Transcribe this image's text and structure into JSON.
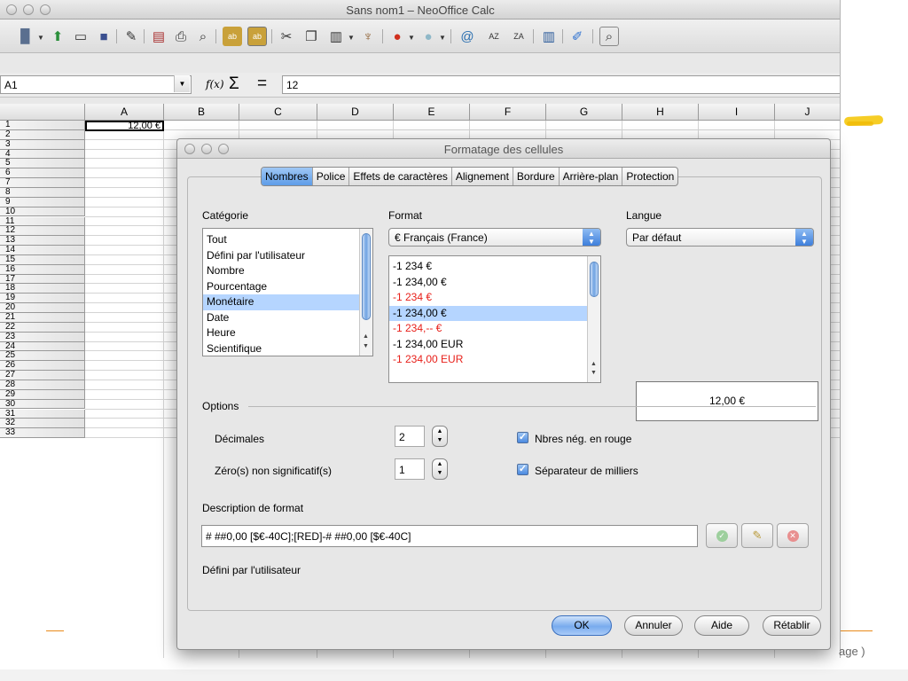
{
  "window": {
    "title": "Sans nom1 – NeoOffice Calc"
  },
  "formula_bar": {
    "cell_ref": "A1",
    "fx": "f(x)",
    "sum": "Σ",
    "equals": "=",
    "value": "12"
  },
  "grid": {
    "columns": [
      "A",
      "B",
      "C",
      "D",
      "E",
      "F",
      "G",
      "H",
      "I",
      "J"
    ],
    "rows": [
      "1",
      "2",
      "3",
      "4",
      "5",
      "6",
      "7",
      "8",
      "9",
      "10",
      "11",
      "12",
      "13",
      "14",
      "15",
      "16",
      "17",
      "18",
      "19",
      "20",
      "21",
      "22",
      "23",
      "24",
      "25",
      "26",
      "27",
      "28",
      "29",
      "30",
      "31",
      "32",
      "33"
    ],
    "a1_value": "12,00 €"
  },
  "dialog": {
    "title": "Formatage des cellules",
    "tabs": [
      "Nombres",
      "Police",
      "Effets de caractères",
      "Alignement",
      "Bordure",
      "Arrière-plan",
      "Protection"
    ],
    "active_tab": "Nombres",
    "category_label": "Catégorie",
    "categories": [
      "Tout",
      "Défini par l'utilisateur",
      "Nombre",
      "Pourcentage",
      "Monétaire",
      "Date",
      "Heure",
      "Scientifique"
    ],
    "selected_category": "Monétaire",
    "format_label": "Format",
    "format_dropdown": "€ Français (France)",
    "formats": [
      {
        "text": "-1 234 €",
        "red": false
      },
      {
        "text": "-1 234,00 €",
        "red": false
      },
      {
        "text": "-1 234 €",
        "red": true
      },
      {
        "text": "-1 234,00 €",
        "red": false,
        "selected": true
      },
      {
        "text": "-1 234,-- €",
        "red": true
      },
      {
        "text": "-1 234,00 EUR",
        "red": false
      },
      {
        "text": "-1 234,00 EUR",
        "red": true
      }
    ],
    "language_label": "Langue",
    "language_dropdown": "Par défaut",
    "preview": "12,00 €",
    "options_label": "Options",
    "decimals_label": "Décimales",
    "decimals_value": "2",
    "leading_zeros_label": "Zéro(s) non significatif(s)",
    "leading_zeros_value": "1",
    "negative_red_label": "Nbres nég. en rouge",
    "thousands_sep_label": "Séparateur de milliers",
    "format_desc_label": "Description de format",
    "format_code": "# ##0,00 [$€-40C];[RED]-# ##0,00 [$€-40C]",
    "user_defined_text": "Défini par l'utilisateur",
    "buttons": {
      "ok": "OK",
      "cancel": "Annuler",
      "help": "Aide",
      "reset": "Rétablir"
    }
  },
  "page_text": "age  )",
  "colors": {
    "selection": "#b5d5ff",
    "accent_blue": "#5e9de8",
    "negative_red": "#e8201a",
    "highlight_yellow": "#f5c400"
  }
}
